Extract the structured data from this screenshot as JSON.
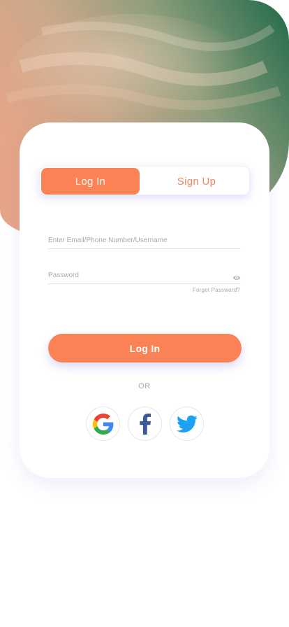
{
  "tabs": {
    "login_label": "Log In",
    "signup_label": "Sign Up"
  },
  "form": {
    "email_placeholder": "Enter Email/Phone Number/Username",
    "password_placeholder": "Password",
    "forgot_label": "Forgot Password?"
  },
  "actions": {
    "login_button_label": "Log In",
    "or_label": "OR"
  },
  "social": [
    {
      "icon": "google-icon"
    },
    {
      "icon": "facebook-icon"
    },
    {
      "icon": "twitter-icon"
    }
  ],
  "colors": {
    "accent": "#fa8254",
    "facebook": "#3b5998",
    "twitter": "#1da1f2"
  }
}
